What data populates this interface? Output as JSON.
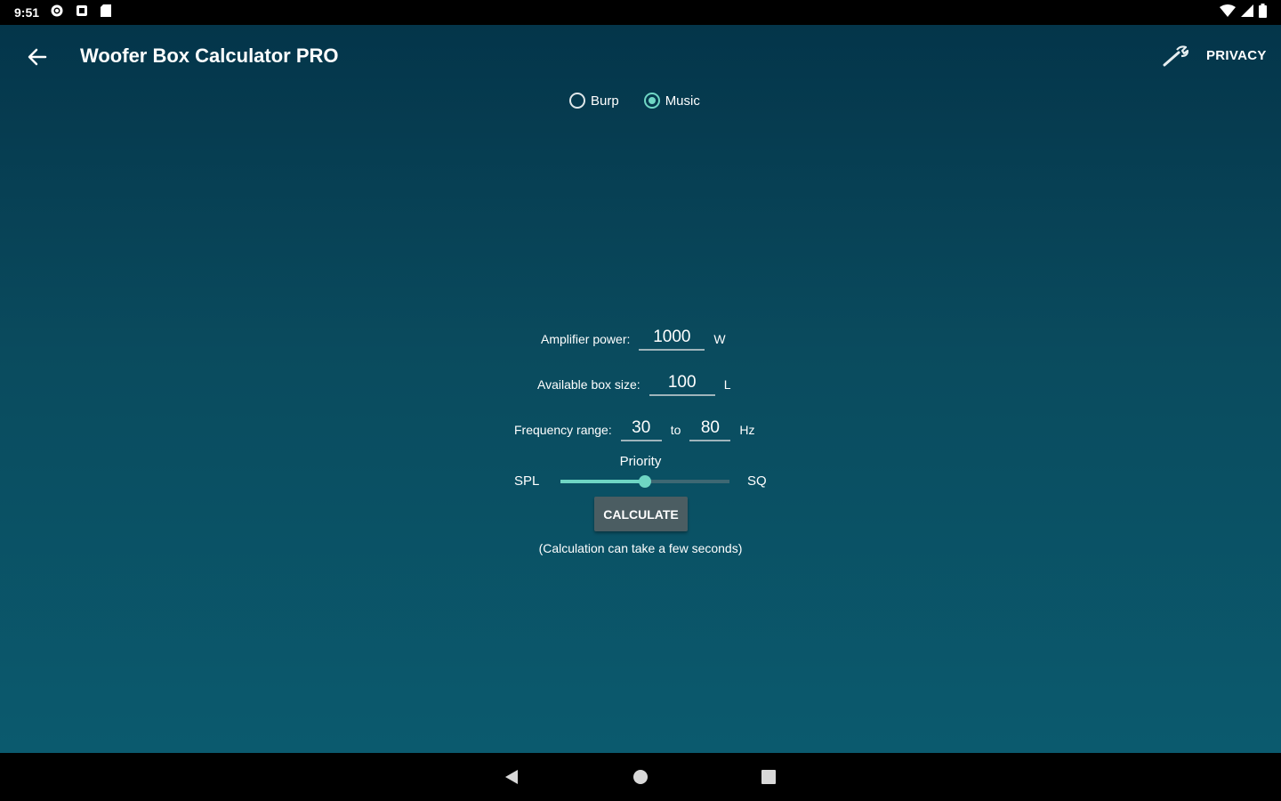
{
  "status_bar": {
    "time": "9:51",
    "left_icons": [
      "settings-status-icon",
      "notification-box-icon",
      "sd-card-icon"
    ],
    "right_icons": [
      "wifi-icon",
      "signal-icon",
      "battery-icon"
    ]
  },
  "app_bar": {
    "title": "Woofer Box Calculator PRO",
    "back_icon": "arrow-back-icon",
    "settings_icon": "wrench-icon",
    "privacy_label": "PRIVACY"
  },
  "mode": {
    "options": [
      {
        "label": "Burp",
        "selected": false
      },
      {
        "label": "Music",
        "selected": true
      }
    ]
  },
  "form": {
    "amplifier": {
      "label": "Amplifier power:",
      "value": "1000",
      "unit": "W"
    },
    "box_size": {
      "label": "Available box size:",
      "value": "100",
      "unit": "L"
    },
    "frequency": {
      "label": "Frequency range:",
      "from": "30",
      "separator": "to",
      "to": "80",
      "unit": "Hz"
    },
    "priority": {
      "label": "Priority",
      "left": "SPL",
      "right": "SQ",
      "value": 0.5
    }
  },
  "calculate_label": "CALCULATE",
  "note": "(Calculation can take a few seconds)",
  "nav_bar": {
    "buttons": [
      "back-triangle-icon",
      "home-circle-icon",
      "recents-square-icon"
    ]
  },
  "colors": {
    "accent": "#6fd6c4",
    "button": "#4b5d62",
    "background_top": "#04354a",
    "background_bottom": "#0b5a6e"
  }
}
